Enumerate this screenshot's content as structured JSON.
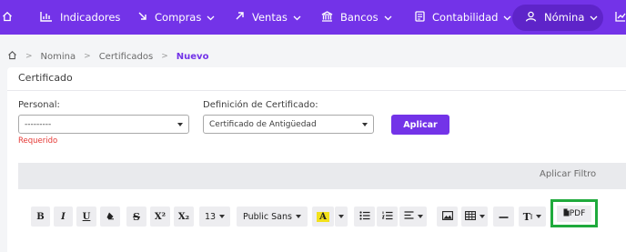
{
  "nav": {
    "items": [
      {
        "label": "Indicadores"
      },
      {
        "label": "Compras"
      },
      {
        "label": "Ventas"
      },
      {
        "label": "Bancos"
      },
      {
        "label": "Contabilidad"
      },
      {
        "label": "Nómina"
      }
    ],
    "active": "Nómina",
    "color": "#7333e8"
  },
  "breadcrumb": {
    "items": [
      "Nomina",
      "Certificados"
    ],
    "current": "Nuevo",
    "separator": ">"
  },
  "card": {
    "title": "Certificado"
  },
  "form": {
    "personal_label": "Personal:",
    "personal_value": "---------",
    "personal_error": "Requerido",
    "definicion_label": "Definición de Certificado:",
    "definicion_value": "Certificado de Antigüedad",
    "apply_label": "Aplicar"
  },
  "filter": {
    "label": "Aplicar Filtro"
  },
  "toolbar": {
    "bold": "B",
    "italic": "I",
    "underline": "U",
    "strike": "S",
    "superscript": "X²",
    "subscript": "X₂",
    "font_size": "13",
    "font_family": "Public Sans",
    "highlight": "A",
    "text_style": "T",
    "pdf_label": "PDF"
  }
}
